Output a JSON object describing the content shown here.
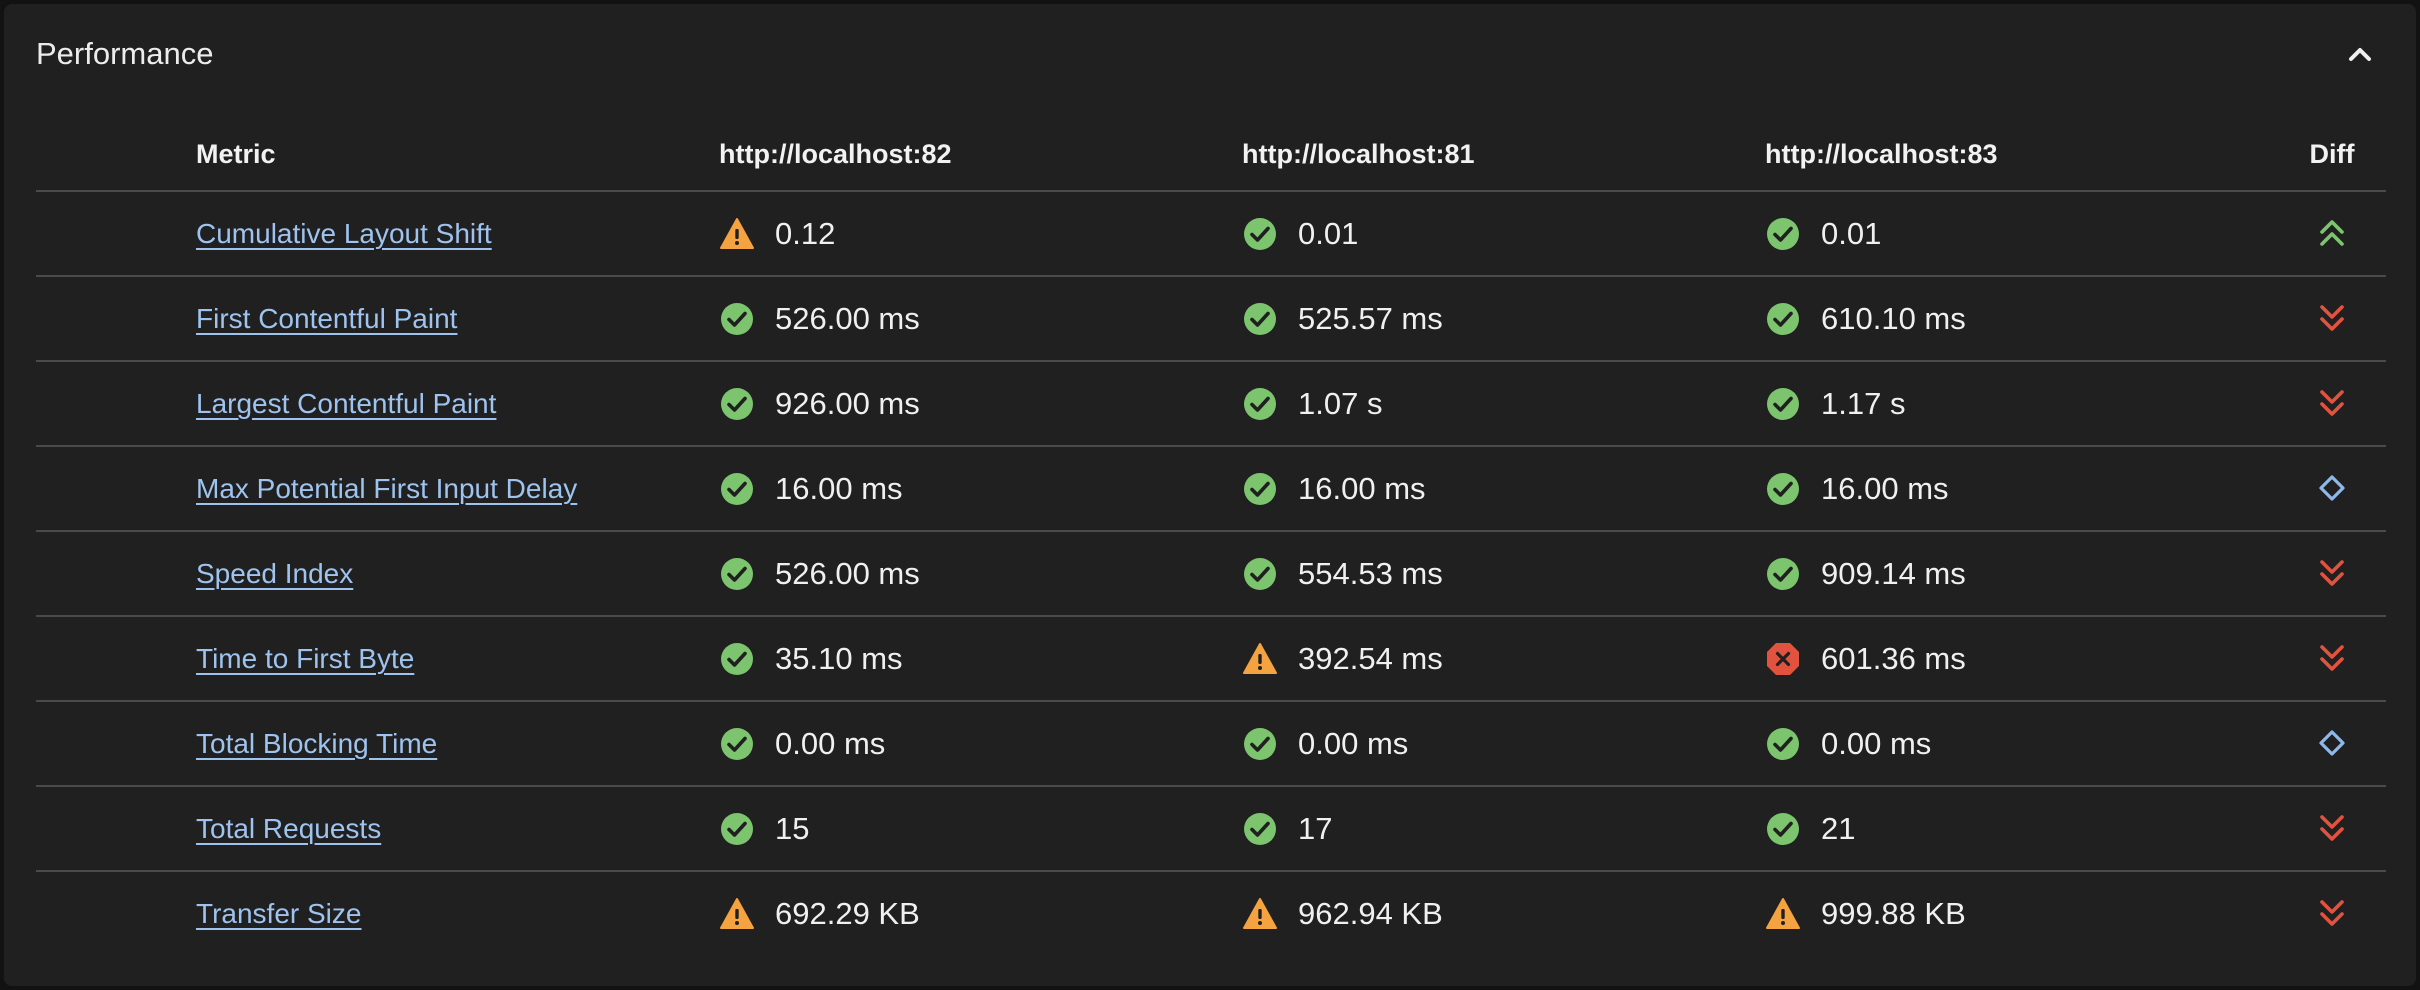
{
  "panel": {
    "title": "Performance"
  },
  "table": {
    "headers": {
      "metric": "Metric",
      "col_a": "http://localhost:82",
      "col_b": "http://localhost:81",
      "col_c": "http://localhost:83",
      "diff": "Diff"
    },
    "rows": [
      {
        "metric": "Cumulative Layout Shift",
        "a": {
          "value": "0.12",
          "status": "warning"
        },
        "b": {
          "value": "0.01",
          "status": "pass"
        },
        "c": {
          "value": "0.01",
          "status": "pass"
        },
        "diff": "improved"
      },
      {
        "metric": "First Contentful Paint",
        "a": {
          "value": "526.00 ms",
          "status": "pass"
        },
        "b": {
          "value": "525.57 ms",
          "status": "pass"
        },
        "c": {
          "value": "610.10 ms",
          "status": "pass"
        },
        "diff": "regressed"
      },
      {
        "metric": "Largest Contentful Paint",
        "a": {
          "value": "926.00 ms",
          "status": "pass"
        },
        "b": {
          "value": "1.07 s",
          "status": "pass"
        },
        "c": {
          "value": "1.17 s",
          "status": "pass"
        },
        "diff": "regressed"
      },
      {
        "metric": "Max Potential First Input Delay",
        "a": {
          "value": "16.00 ms",
          "status": "pass"
        },
        "b": {
          "value": "16.00 ms",
          "status": "pass"
        },
        "c": {
          "value": "16.00 ms",
          "status": "pass"
        },
        "diff": "unchanged"
      },
      {
        "metric": "Speed Index",
        "a": {
          "value": "526.00 ms",
          "status": "pass"
        },
        "b": {
          "value": "554.53 ms",
          "status": "pass"
        },
        "c": {
          "value": "909.14 ms",
          "status": "pass"
        },
        "diff": "regressed"
      },
      {
        "metric": "Time to First Byte",
        "a": {
          "value": "35.10 ms",
          "status": "pass"
        },
        "b": {
          "value": "392.54 ms",
          "status": "warning"
        },
        "c": {
          "value": "601.36 ms",
          "status": "fail"
        },
        "diff": "regressed"
      },
      {
        "metric": "Total Blocking Time",
        "a": {
          "value": "0.00 ms",
          "status": "pass"
        },
        "b": {
          "value": "0.00 ms",
          "status": "pass"
        },
        "c": {
          "value": "0.00 ms",
          "status": "pass"
        },
        "diff": "unchanged"
      },
      {
        "metric": "Total Requests",
        "a": {
          "value": "15",
          "status": "pass"
        },
        "b": {
          "value": "17",
          "status": "pass"
        },
        "c": {
          "value": "21",
          "status": "pass"
        },
        "diff": "regressed"
      },
      {
        "metric": "Transfer Size",
        "a": {
          "value": "692.29 KB",
          "status": "warning"
        },
        "b": {
          "value": "962.94 KB",
          "status": "warning"
        },
        "c": {
          "value": "999.88 KB",
          "status": "warning"
        },
        "diff": "regressed"
      }
    ]
  },
  "icons": {
    "pass": "check-circle-icon",
    "warning": "warning-triangle-icon",
    "fail": "error-octagon-icon",
    "improved": "double-chevron-up-icon",
    "regressed": "double-chevron-down-icon",
    "unchanged": "diamond-icon",
    "collapse": "chevron-up-icon"
  },
  "colors": {
    "pass": "#7cc46e",
    "warning": "#f4a340",
    "fail": "#e2533f",
    "improved": "#7cc46e",
    "regressed": "#e2533f",
    "unchanged": "#8fb8ea",
    "link": "#9fc3ef",
    "panel_bg": "#202020"
  }
}
